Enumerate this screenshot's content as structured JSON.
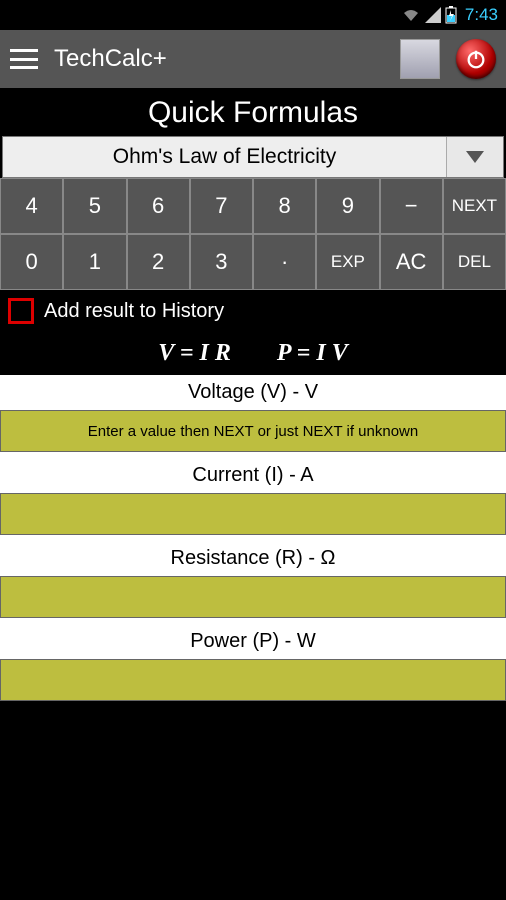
{
  "status": {
    "time": "7:43"
  },
  "app": {
    "title": "TechCalc+"
  },
  "section": {
    "title": "Quick Formulas"
  },
  "dropdown": {
    "selected": "Ohm's Law of Electricity"
  },
  "keypad": {
    "row1": [
      "4",
      "5",
      "6",
      "7",
      "8",
      "9",
      "−",
      "NEXT"
    ],
    "row2": [
      "0",
      "1",
      "2",
      "3",
      "·",
      "EXP",
      "AC",
      "DEL"
    ]
  },
  "checkbox": {
    "label": "Add result to History"
  },
  "formulas": {
    "f1": "V = I R",
    "f2": "P = I V"
  },
  "fields": [
    {
      "label": "Voltage (V) - V",
      "value": "Enter a value then NEXT or just NEXT if unknown"
    },
    {
      "label": "Current (I) - A",
      "value": ""
    },
    {
      "label": "Resistance (R) - Ω",
      "value": ""
    },
    {
      "label": "Power (P) - W",
      "value": ""
    }
  ]
}
